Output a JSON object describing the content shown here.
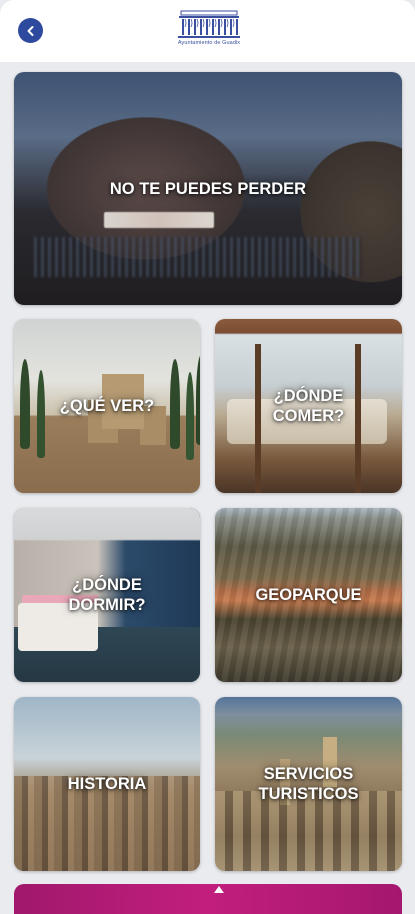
{
  "header": {
    "logo_title": "Ayuntamiento de Guadix",
    "logo_subtitle": "",
    "back_icon": "chevron-left-icon",
    "accent_color": "#2e4a9e"
  },
  "tiles": [
    {
      "label": "NO TE PUEDES PERDER"
    },
    {
      "label": "¿QUÉ VER?"
    },
    {
      "label": "¿DÓNDE\nCOMER?"
    },
    {
      "label": "¿DÓNDE\nDORMIR?"
    },
    {
      "label": "GEOPARQUE"
    },
    {
      "label": "HISTORIA"
    },
    {
      "label": "SERVICIOS\nTURISTICOS"
    }
  ],
  "bottom_tile": {
    "color": "#b81a78"
  }
}
